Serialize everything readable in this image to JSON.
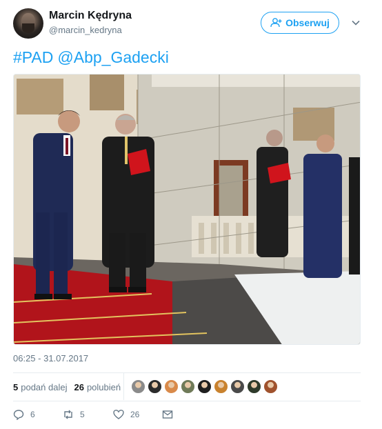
{
  "author": {
    "name": "Marcin Kędryna",
    "handle": "@marcin_kedryna",
    "avatar_icon": "avatar-photo"
  },
  "follow_button": {
    "label": "Obserwuj",
    "icon": "add-user-icon"
  },
  "more_menu_icon": "chevron-down-icon",
  "tweet": {
    "hashtag": "#PAD",
    "mention": "@Abp_Gadecki"
  },
  "photo": {
    "icon": "embedded-photo"
  },
  "timestamp": "06:25 - 31.07.2017",
  "stats": {
    "retweets_count": "5",
    "retweets_label": "podań dalej",
    "likes_count": "26",
    "likes_label": "polubień"
  },
  "likers": [
    {
      "color": "#8a8a8a"
    },
    {
      "color": "#2b2b2b"
    },
    {
      "color": "#d98a4a"
    },
    {
      "color": "#6f7a58"
    },
    {
      "color": "#1f1f1f"
    },
    {
      "color": "#c9822e"
    },
    {
      "color": "#4a4a4a"
    },
    {
      "color": "#2e3a2a"
    },
    {
      "color": "#a0522d"
    }
  ],
  "actions": {
    "reply_count": "6",
    "retweet_count": "5",
    "like_count": "26"
  },
  "colors": {
    "accent": "#1da1f2",
    "muted": "#657786",
    "text": "#14171a",
    "border": "#e6ecf0"
  }
}
